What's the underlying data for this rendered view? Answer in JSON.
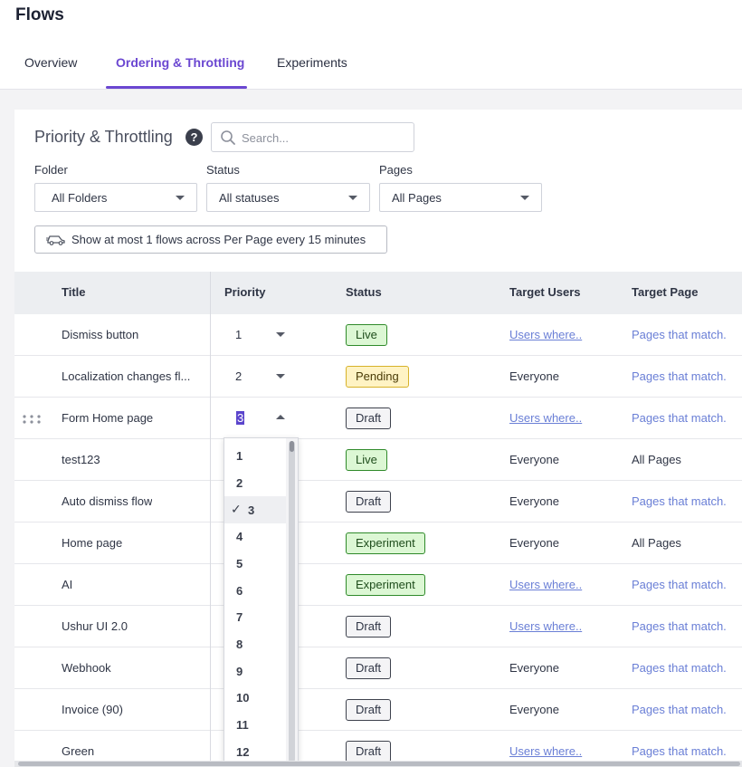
{
  "app": {
    "title": "Flows"
  },
  "tabs": [
    {
      "label": "Overview",
      "active": false
    },
    {
      "label": "Ordering & Throttling",
      "active": true
    },
    {
      "label": "Experiments",
      "active": false
    }
  ],
  "section": {
    "title": "Priority & Throttling",
    "help_icon": "question-circle-icon"
  },
  "search": {
    "placeholder": "Search...",
    "value": ""
  },
  "filters": {
    "folder": {
      "label": "Folder",
      "value": "All Folders"
    },
    "status": {
      "label": "Status",
      "value": "All statuses"
    },
    "pages": {
      "label": "Pages",
      "value": "All Pages"
    }
  },
  "throttle": {
    "label": "Show at most 1 flows across Per Page every 15 minutes",
    "icon": "car-icon"
  },
  "table": {
    "headers": {
      "title": "Title",
      "priority": "Priority",
      "status": "Status",
      "target_users": "Target Users",
      "target_page": "Target Page"
    },
    "rows": [
      {
        "title": "Dismiss button",
        "priority": "1",
        "status": "Live",
        "target_users": "Users where..",
        "target_page": "Pages that match."
      },
      {
        "title": "Localization changes fl...",
        "priority": "2",
        "status": "Pending",
        "target_users": "Everyone",
        "target_page": "Pages that match."
      },
      {
        "title": "Form Home page",
        "priority": "3",
        "status": "Draft",
        "target_users": "Users where..",
        "target_page": "Pages that match."
      },
      {
        "title": "test123",
        "priority": "",
        "status": "Live",
        "target_users": "Everyone",
        "target_page": "All Pages"
      },
      {
        "title": "Auto dismiss flow",
        "priority": "",
        "status": "Draft",
        "target_users": "Everyone",
        "target_page": "Pages that match."
      },
      {
        "title": "Home page",
        "priority": "",
        "status": "Experiment",
        "target_users": "Everyone",
        "target_page": "All Pages"
      },
      {
        "title": "AI",
        "priority": "",
        "status": "Experiment",
        "target_users": "Users where..",
        "target_page": "Pages that match."
      },
      {
        "title": "Ushur UI 2.0",
        "priority": "",
        "status": "Draft",
        "target_users": "Users where..",
        "target_page": "Pages that match."
      },
      {
        "title": "Webhook",
        "priority": "",
        "status": "Draft",
        "target_users": "Everyone",
        "target_page": "Pages that match."
      },
      {
        "title": "Invoice (90)",
        "priority": "",
        "status": "Draft",
        "target_users": "Everyone",
        "target_page": "Pages that match."
      },
      {
        "title": "Green",
        "priority": "",
        "status": "Draft",
        "target_users": "Users where..",
        "target_page": "Pages that match."
      }
    ]
  },
  "priority_dropdown": {
    "options": [
      "1",
      "2",
      "3",
      "4",
      "5",
      "6",
      "7",
      "8",
      "9",
      "10",
      "11",
      "12"
    ],
    "selected": "3",
    "check_glyph": "✓"
  },
  "colors": {
    "accent": "#6b47d1",
    "link": "#6a7fd6",
    "live_bg": "#dcf7d4",
    "pending_bg": "#fff3c4",
    "draft_bg": "#f4f4f6"
  }
}
